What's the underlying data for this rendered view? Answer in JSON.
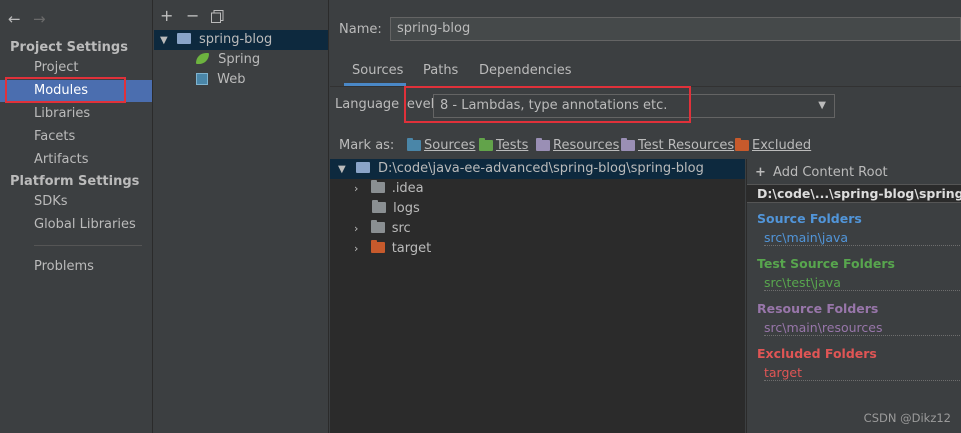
{
  "sidebar": {
    "back_icon": "arrow-left-icon",
    "forward_icon": "arrow-right-icon",
    "project_settings_title": "Project Settings",
    "project_items": [
      "Project",
      "Modules",
      "Libraries",
      "Facets",
      "Artifacts"
    ],
    "platform_settings_title": "Platform Settings",
    "platform_items": [
      "SDKs",
      "Global Libraries"
    ],
    "problems": "Problems",
    "selected": "Modules"
  },
  "module_tree": {
    "toolbar": {
      "add": "+",
      "remove": "−",
      "copy_icon": "copy-icon"
    },
    "module": "spring-blog",
    "facets": [
      "Spring",
      "Web"
    ]
  },
  "module_settings": {
    "name_label": "Name:",
    "name_value": "spring-blog",
    "tabs": [
      "Sources",
      "Paths",
      "Dependencies"
    ],
    "active_tab": "Sources",
    "language_level_label": "Language level:",
    "language_level_value": "8 - Lambdas, type annotations etc.",
    "mark_as_label": "Mark as:",
    "mark_as": [
      {
        "label": "Sources",
        "color": "#4a86a8"
      },
      {
        "label": "Tests",
        "color": "#62a34a"
      },
      {
        "label": "Resources",
        "color": "#9a8fb5"
      },
      {
        "label": "Test Resources",
        "color": "#9a8fb5"
      },
      {
        "label": "Excluded",
        "color": "#c75a2c"
      }
    ]
  },
  "content_tree": {
    "root": "D:\\code\\java-ee-advanced\\spring-blog\\spring-blog",
    "children": [
      ".idea",
      "logs",
      "src",
      "target"
    ]
  },
  "content_roots": {
    "add_content_root": "Add Content Root",
    "root_path": "D:\\code\\...\\spring-blog\\spring-blog",
    "source_folders_title": "Source Folders",
    "source_folders": [
      "src\\main\\java"
    ],
    "test_source_folders_title": "Test Source Folders",
    "test_source_folders": [
      "src\\test\\java"
    ],
    "resource_folders_title": "Resource Folders",
    "resource_folders": [
      "src\\main\\resources"
    ],
    "excluded_folders_title": "Excluded Folders",
    "excluded_folders": [
      "target"
    ]
  },
  "watermark": "CSDN @Dikz12",
  "colors": {
    "selection": "#4b6eaf",
    "source": "#5195d9",
    "test": "#58a64e",
    "resource": "#9876aa",
    "excluded": "#e05555",
    "highlight_box": "#e0313a"
  }
}
